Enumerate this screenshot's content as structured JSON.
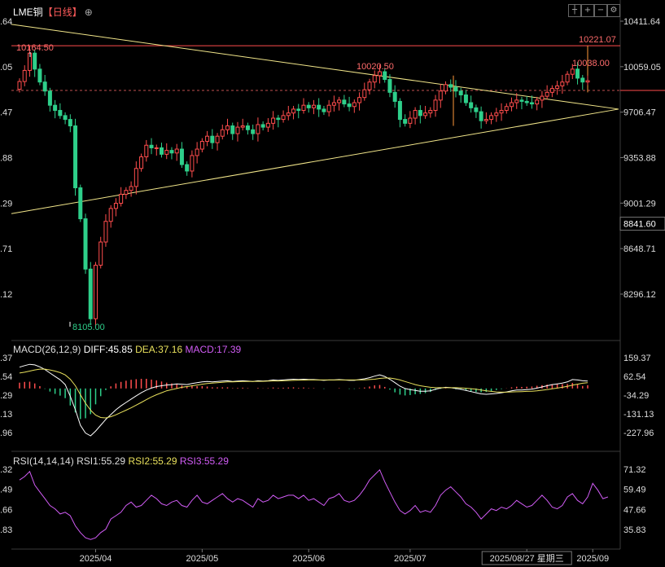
{
  "header": {
    "symbol": "LME铜",
    "period": "【日线】",
    "toolbar_icons": [
      "crosshair-icon",
      "add-icon",
      "minus-icon",
      "settings-icon"
    ]
  },
  "colors": {
    "up": "#ff4d4d",
    "down": "#2ecf8a",
    "wedge": "#f2e68a",
    "diff": "#ffffff",
    "dea": "#e8e05c",
    "rsi": "#d15cf5",
    "price_label": "#ff6b6b",
    "grid": "#2a2a2a"
  },
  "main_axis": {
    "ticks": [
      "10411.64",
      "10059.05",
      "9706.47",
      "9353.88",
      "9001.29",
      "8648.71",
      "8296.12"
    ],
    "left_ticks": [
      ".64",
      ".05",
      ".47",
      ".88",
      ".29",
      ".71",
      ".12"
    ],
    "current_price": "8841.60",
    "reference_price": "9875.00",
    "ylim": [
      8105,
      10420
    ]
  },
  "annotations": {
    "high_left": "10164.50",
    "high_mid": "10020.50",
    "target": "10221.07",
    "high_right": "10038.00",
    "low": "8105.00"
  },
  "x_axis": {
    "labels": [
      "2025/04",
      "2025/05",
      "2025/06",
      "2025/07",
      "2025/08/27 星期三",
      "2025/09"
    ],
    "label_index": [
      15,
      36,
      57,
      77,
      100,
      113
    ]
  },
  "macd": {
    "title": "MACD(26,12,9)",
    "diff_label": "DIFF:45.85",
    "dea_label": "DEA:37.16",
    "macd_label": "MACD:17.39",
    "ticks": [
      "159.37",
      "62.54",
      "-34.29",
      "-131.13",
      "-227.96"
    ],
    "left_ticks": [
      ".37",
      ".54",
      ".29",
      ".13",
      ".96"
    ],
    "ylim": [
      -270,
      190
    ]
  },
  "rsi": {
    "title": "RSI(14,14,14)",
    "rsi1_label": "RSI1:55.29",
    "rsi2_label": "RSI2:55.29",
    "rsi3_label": "RSI3:55.29",
    "ticks": [
      "71.32",
      "59.49",
      "47.66",
      "35.83"
    ],
    "left_ticks": [
      ".32",
      ".49",
      ".66",
      ".83"
    ],
    "ylim": [
      30,
      75
    ]
  },
  "chart_data": {
    "type": "candlestick",
    "title": "LME铜【日线】",
    "series_closes": [
      9944,
      10030,
      10164,
      10040,
      9940,
      9870,
      9760,
      9720,
      9680,
      9650,
      9600,
      9120,
      8880,
      8490,
      8105,
      8520,
      8700,
      8860,
      8960,
      9000,
      9070,
      9100,
      9130,
      9270,
      9360,
      9450,
      9430,
      9430,
      9380,
      9410,
      9390,
      9420,
      9300,
      9250,
      9370,
      9420,
      9480,
      9520,
      9470,
      9520,
      9570,
      9600,
      9540,
      9590,
      9600,
      9570,
      9540,
      9610,
      9590,
      9620,
      9660,
      9650,
      9680,
      9700,
      9730,
      9720,
      9760,
      9740,
      9760,
      9730,
      9710,
      9760,
      9780,
      9800,
      9770,
      9750,
      9780,
      9820,
      9880,
      9940,
      9990,
      10020,
      9960,
      9860,
      9790,
      9650,
      9620,
      9660,
      9720,
      9680,
      9700,
      9720,
      9800,
      9870,
      9920,
      9900,
      9870,
      9840,
      9780,
      9740,
      9710,
      9640,
      9650,
      9680,
      9700,
      9720,
      9750,
      9780,
      9800,
      9790,
      9780,
      9770,
      9800,
      9830,
      9860,
      9890,
      9910,
      9940,
      10000,
      10040,
      9970,
      9940,
      9950
    ],
    "ylim": [
      8105,
      10420
    ],
    "macd_diff": [
      110,
      118,
      125,
      122,
      112,
      98,
      80,
      62,
      45,
      20,
      -40,
      -110,
      -190,
      -230,
      -245,
      -220,
      -190,
      -160,
      -135,
      -110,
      -90,
      -72,
      -55,
      -38,
      -22,
      -8,
      2,
      10,
      14,
      18,
      20,
      24,
      22,
      20,
      26,
      30,
      34,
      36,
      34,
      36,
      38,
      40,
      36,
      38,
      40,
      38,
      36,
      40,
      38,
      40,
      44,
      42,
      44,
      46,
      48,
      46,
      48,
      46,
      46,
      44,
      42,
      44,
      44,
      46,
      44,
      42,
      42,
      46,
      50,
      56,
      64,
      70,
      62,
      48,
      30,
      12,
      0,
      -6,
      -10,
      -14,
      -14,
      -12,
      -4,
      2,
      6,
      4,
      0,
      -4,
      -10,
      -16,
      -22,
      -28,
      -30,
      -28,
      -26,
      -22,
      -18,
      -12,
      -8,
      -8,
      -6,
      -4,
      2,
      8,
      14,
      20,
      24,
      28,
      34,
      46,
      44,
      40,
      38
    ],
    "macd_dea": [
      80,
      84,
      90,
      96,
      100,
      100,
      96,
      90,
      82,
      70,
      48,
      14,
      -32,
      -76,
      -112,
      -138,
      -150,
      -152,
      -146,
      -136,
      -124,
      -112,
      -100,
      -86,
      -72,
      -58,
      -44,
      -32,
      -22,
      -12,
      -6,
      0,
      6,
      10,
      14,
      18,
      22,
      26,
      28,
      30,
      32,
      34,
      34,
      35,
      36,
      36,
      36,
      37,
      37,
      38,
      39,
      39,
      40,
      41,
      42,
      43,
      43,
      44,
      44,
      44,
      44,
      44,
      44,
      44,
      44,
      44,
      44,
      44,
      45,
      46,
      48,
      52,
      54,
      54,
      50,
      44,
      36,
      28,
      20,
      14,
      10,
      6,
      4,
      4,
      4,
      4,
      4,
      3,
      1,
      -1,
      -4,
      -8,
      -12,
      -15,
      -18,
      -19,
      -19,
      -18,
      -17,
      -16,
      -15,
      -14,
      -12,
      -9,
      -6,
      -2,
      2,
      6,
      11,
      17,
      22,
      27,
      30
    ],
    "macd_hist": [
      30,
      34,
      35,
      26,
      12,
      -2,
      -16,
      -28,
      -37,
      -50,
      -88,
      -124,
      -158,
      -154,
      -133,
      -82,
      -40,
      -8,
      11,
      26,
      34,
      40,
      45,
      48,
      50,
      50,
      46,
      42,
      36,
      30,
      26,
      24,
      16,
      10,
      12,
      12,
      12,
      10,
      6,
      6,
      6,
      6,
      2,
      3,
      4,
      2,
      0,
      3,
      1,
      2,
      5,
      3,
      4,
      5,
      6,
      3,
      5,
      2,
      2,
      0,
      -2,
      0,
      0,
      2,
      0,
      -2,
      -2,
      2,
      5,
      10,
      16,
      18,
      8,
      -6,
      -20,
      -32,
      -36,
      -34,
      -30,
      -28,
      -24,
      -18,
      -8,
      -2,
      2,
      0,
      -4,
      -7,
      -11,
      -15,
      -18,
      -20,
      -18,
      -13,
      -8,
      -3,
      1,
      6,
      9,
      8,
      9,
      10,
      14,
      17,
      20,
      22,
      22,
      22,
      23,
      29,
      22,
      13,
      17
    ],
    "macd_ylim": [
      -270,
      190
    ],
    "rsi_values": [
      65,
      67,
      70,
      62,
      58,
      54,
      50,
      48,
      45,
      46,
      44,
      38,
      34,
      31,
      30,
      31,
      34,
      36,
      42,
      44,
      46,
      50,
      52,
      49,
      50,
      53,
      56,
      54,
      51,
      50,
      52,
      53,
      50,
      49,
      53,
      56,
      52,
      51,
      53,
      55,
      57,
      54,
      52,
      54,
      53,
      51,
      49,
      54,
      52,
      53,
      56,
      54,
      55,
      56,
      56,
      54,
      56,
      53,
      54,
      52,
      50,
      54,
      55,
      57,
      53,
      52,
      53,
      56,
      60,
      65,
      68,
      71,
      64,
      58,
      52,
      47,
      45,
      47,
      50,
      46,
      47,
      46,
      50,
      56,
      59,
      61,
      58,
      55,
      51,
      49,
      46,
      42,
      45,
      48,
      47,
      49,
      48,
      50,
      53,
      51,
      49,
      50,
      53,
      56,
      53,
      49,
      48,
      50,
      55,
      57,
      53,
      51,
      55,
      63,
      59,
      54,
      55
    ],
    "rsi_ylim": [
      30,
      75
    ]
  }
}
